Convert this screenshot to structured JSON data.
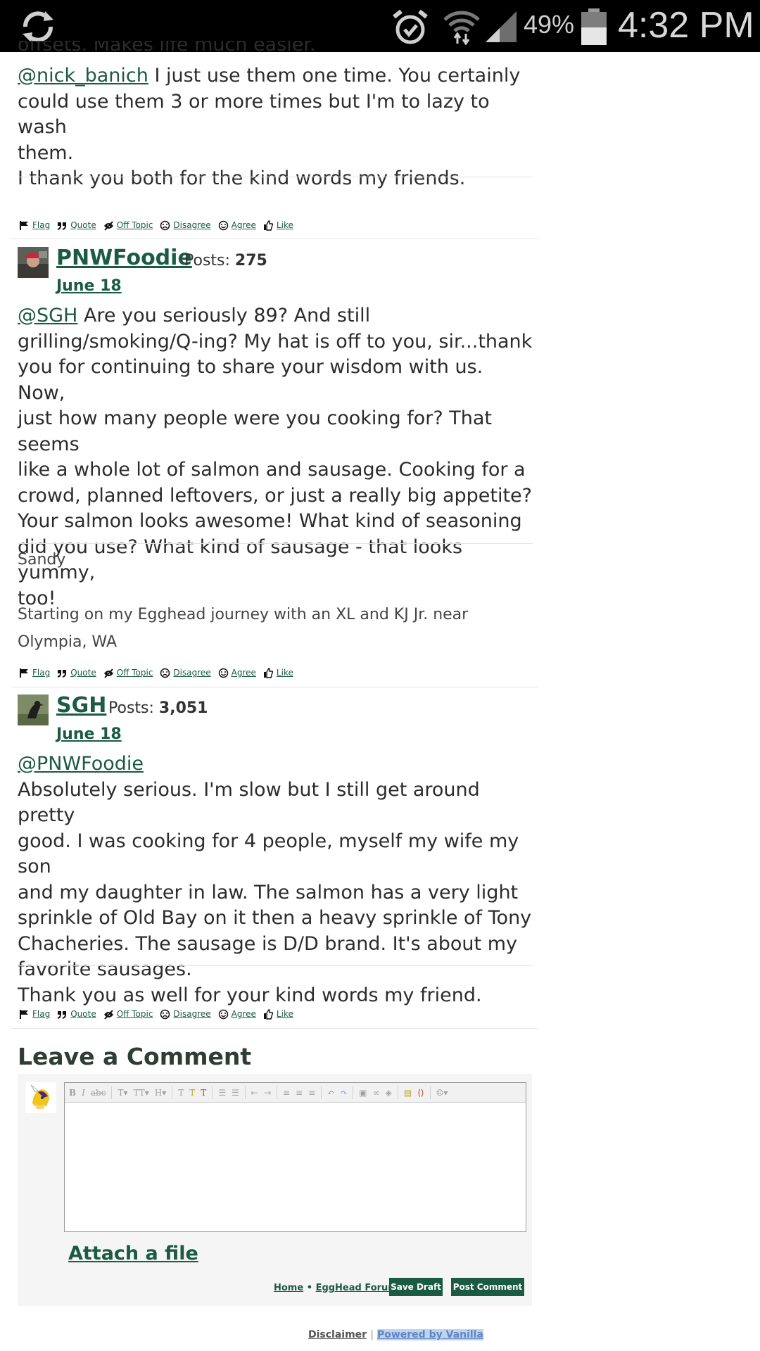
{
  "status_bar": {
    "battery_pct": "49%",
    "time": "4:32 PM",
    "icons": [
      "sync-icon",
      "alarm-icon",
      "wifi-icon",
      "signal-icon",
      "battery-icon"
    ]
  },
  "post1": {
    "top_partial": "offsets. Makes life much easier.",
    "mention": "@nick_banich",
    "line1_rest": " I just use them one time. You certainly",
    "line2": "could use them 3 or more times but I'm to lazy to wash",
    "line3": "them.",
    "line4": "I thank you both for the kind words my friends."
  },
  "actions": {
    "flag": "Flag",
    "quote": "Quote",
    "off_topic": "Off Topic",
    "disagree": "Disagree",
    "agree": "Agree",
    "like": "Like"
  },
  "post2": {
    "author": "PNWFoodie",
    "posts_label": "Posts:",
    "posts_count": "275",
    "date": "June 18",
    "mention": "@SGH",
    "lines": [
      " Are you seriously 89? And still",
      "grilling/smoking/Q-ing? My hat is off to you, sir...thank",
      "you for continuing to share your wisdom with us. Now,",
      "just how many people were you cooking for? That seems",
      "like a whole lot of salmon and sausage. Cooking for a",
      "crowd, planned leftovers, or just a really big appetite?",
      "Your salmon looks awesome! What kind of seasoning",
      "did you use? What kind of sausage - that looks yummy,",
      "too!"
    ],
    "signature": {
      "name": "Sandy",
      "line1": "Starting on my Egghead journey with an XL and KJ Jr. near",
      "line2": "Olympia, WA"
    }
  },
  "post3": {
    "author": "SGH",
    "posts_label": "Posts:",
    "posts_count": "3,051",
    "date": "June 18",
    "mention": "@PNWFoodie",
    "lines": [
      "Absolutely serious. I'm slow but I still get around pretty",
      "good. I was cooking for 4 people, myself my wife my son",
      "and my daughter in law. The salmon has a very light",
      "sprinkle of Old Bay on it then a heavy sprinkle of Tony",
      "Chacheries. The sausage is D/D brand. It's about my",
      "favorite sausages.",
      "Thank you as well for your kind words my friend."
    ]
  },
  "comment": {
    "title": "Leave a Comment",
    "attach": "Attach a file",
    "home": "Home",
    "sep": " • ",
    "forum": "EggHead Forum",
    "save_draft": "Save Draft",
    "post_comment": "Post Comment"
  },
  "footer": {
    "disclaimer": "Disclaimer",
    "powered": "Powered by Vanilla"
  }
}
